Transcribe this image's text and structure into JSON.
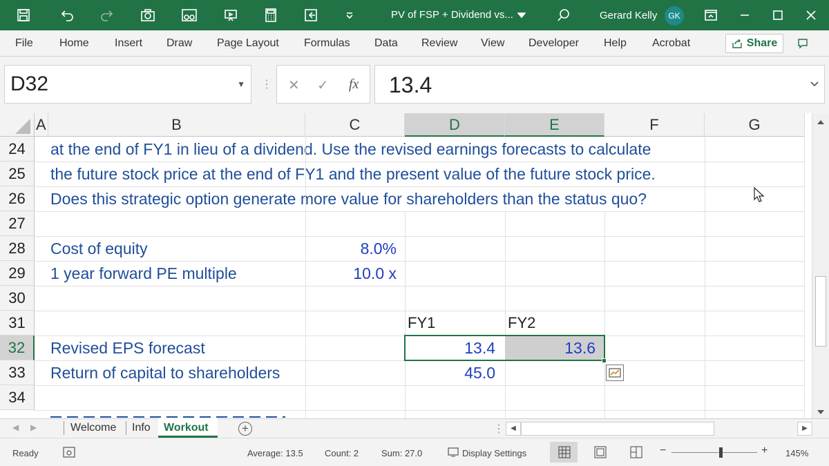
{
  "titlebar": {
    "doc_title": "PV of FSP + Dividend vs...",
    "user_name": "Gerard Kelly",
    "user_initials": "GK",
    "accent_color": "#217346"
  },
  "ribbon": {
    "tabs": [
      "File",
      "Home",
      "Insert",
      "Draw",
      "Page Layout",
      "Formulas",
      "Data",
      "Review",
      "View",
      "Developer",
      "Help",
      "Acrobat"
    ],
    "share_label": "Share"
  },
  "formula_bar": {
    "name_box": "D32",
    "fx_label": "fx",
    "value": "13.4"
  },
  "columns": [
    "A",
    "B",
    "C",
    "D",
    "E",
    "F",
    "G"
  ],
  "rows": [
    "24",
    "25",
    "26",
    "27",
    "28",
    "29",
    "30",
    "31",
    "32",
    "33",
    "34"
  ],
  "cells": {
    "r24_b": "at the end of FY1 in lieu of a dividend. Use the revised earnings forecasts to calculate",
    "r25_b": "the future stock price at the end of FY1 and the present value of the future stock price.",
    "r26_b": "Does this strategic option generate more value for shareholders than the status quo?",
    "r28_b": "Cost of equity",
    "r28_c": "8.0%",
    "r29_b": "1 year forward PE multiple",
    "r29_c": "10.0 x",
    "r31_d": "FY1",
    "r31_e": "FY2",
    "r32_b": "Revised EPS forecast",
    "r32_d": "13.4",
    "r32_e": "13.6",
    "r33_b": "Return of capital to shareholders",
    "r33_d": "45.0"
  },
  "sheets": {
    "tabs": [
      "Welcome",
      "Info",
      "Workout"
    ],
    "active": "Workout"
  },
  "statusbar": {
    "mode": "Ready",
    "average": "Average: 13.5",
    "count": "Count: 2",
    "sum": "Sum: 27.0",
    "display_settings": "Display Settings",
    "zoom": "145%"
  }
}
